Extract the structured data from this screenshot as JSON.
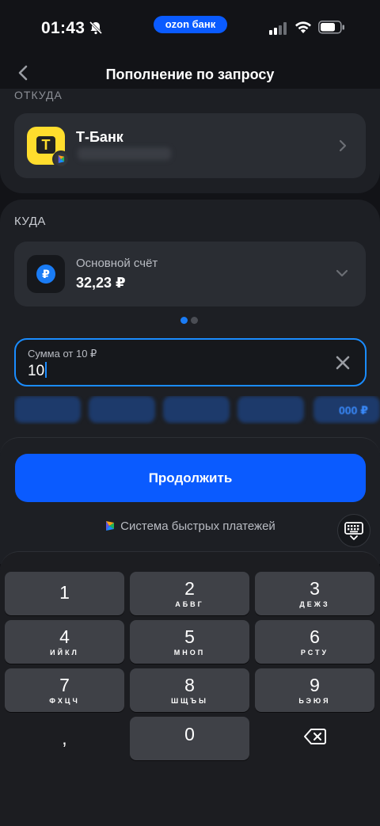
{
  "status_bar": {
    "time": "01:43",
    "carrier_badge": "ozon банк"
  },
  "header": {
    "title": "Пополнение по запросу"
  },
  "from": {
    "label": "ОТКУДА",
    "bank_name": "Т-Банк",
    "logo_letter": "Т"
  },
  "to": {
    "label": "КУДА",
    "account_name": "Основной счёт",
    "balance": "32,23 ₽",
    "icon_glyph": "₽"
  },
  "amount": {
    "label": "Сумма от 10 ₽",
    "value": "10"
  },
  "quick_amounts": {
    "visible_partial_text": "000 ₽"
  },
  "sheet": {
    "continue_label": "Продолжить",
    "sbp_label": "Система быстрых платежей"
  },
  "keyboard": {
    "keys": [
      {
        "num": "1",
        "letters": ""
      },
      {
        "num": "2",
        "letters": "АБВГ"
      },
      {
        "num": "3",
        "letters": "ДЕЖЗ"
      },
      {
        "num": "4",
        "letters": "ИЙКЛ"
      },
      {
        "num": "5",
        "letters": "МНОП"
      },
      {
        "num": "6",
        "letters": "РСТУ"
      },
      {
        "num": "7",
        "letters": "ФХЦЧ"
      },
      {
        "num": "8",
        "letters": "ШЩЪЫ"
      },
      {
        "num": "9",
        "letters": "ЬЭЮЯ"
      },
      {
        "num": ",",
        "letters": ""
      },
      {
        "num": "0",
        "letters": ""
      }
    ]
  },
  "colors": {
    "accent": "#0a5bff",
    "field_border": "#1a8cff",
    "background": "#121317",
    "card": "#1d1f24",
    "tbank_yellow": "#ffdd2d"
  }
}
